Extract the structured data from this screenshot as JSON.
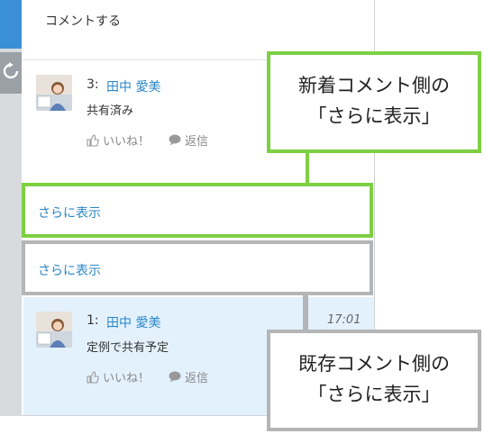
{
  "comment_box": {
    "label": "コメントする"
  },
  "new_comment": {
    "number": "3:",
    "author": "田中 愛美",
    "text": "共有済み",
    "like_label": "いいね！",
    "reply_label": "返信"
  },
  "new_show_more": {
    "label": "さらに表示"
  },
  "old_show_more": {
    "label": "さらに表示"
  },
  "old_comment": {
    "number": "1:",
    "author": "田中 愛美",
    "text": "定例で共有予定",
    "time": "17:01",
    "like_label": "いいね！",
    "reply_label": "返信"
  },
  "annotations": {
    "new_side": {
      "line1": "新着コメント側の",
      "line2": "「さらに表示」"
    },
    "old_side": {
      "line1": "既存コメント側の",
      "line2": "「さらに表示」"
    }
  },
  "colors": {
    "green_border": "#7ed043",
    "gray_border": "#b3b5b7",
    "link_blue": "#2a86c6",
    "old_comment_bg": "#e3f1fd",
    "side_tab_blue": "#3b8fd6"
  }
}
